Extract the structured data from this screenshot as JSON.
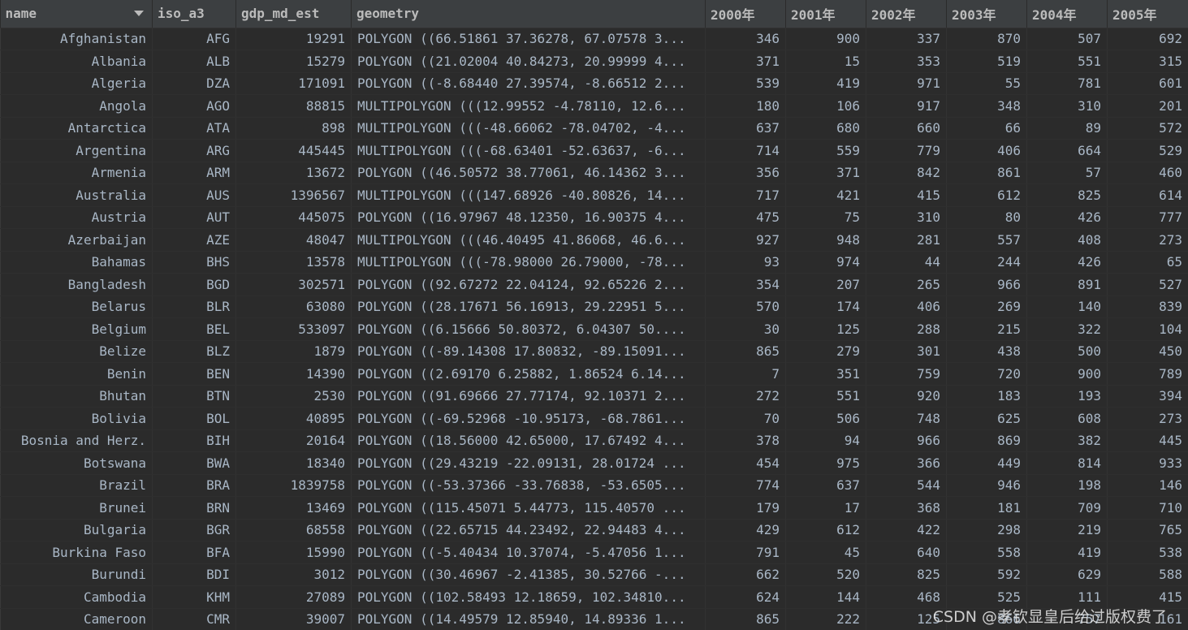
{
  "table": {
    "columns": [
      "name",
      "iso_a3",
      "gdp_md_est",
      "geometry",
      "2000年",
      "2001年",
      "2002年",
      "2003年",
      "2004年",
      "2005年"
    ],
    "sorted_column_icon": "sort-desc-icon",
    "rows": [
      [
        "Afghanistan",
        "AFG",
        "19291",
        "POLYGON ((66.51861 37.36278, 67.07578 3...",
        "346",
        "900",
        "337",
        "870",
        "507",
        "692"
      ],
      [
        "Albania",
        "ALB",
        "15279",
        "POLYGON ((21.02004 40.84273, 20.99999 4...",
        "371",
        "15",
        "353",
        "519",
        "551",
        "315"
      ],
      [
        "Algeria",
        "DZA",
        "171091",
        "POLYGON ((-8.68440 27.39574, -8.66512 2...",
        "539",
        "419",
        "971",
        "55",
        "781",
        "601"
      ],
      [
        "Angola",
        "AGO",
        "88815",
        "MULTIPOLYGON (((12.99552 -4.78110, 12.6...",
        "180",
        "106",
        "917",
        "348",
        "310",
        "201"
      ],
      [
        "Antarctica",
        "ATA",
        "898",
        "MULTIPOLYGON (((-48.66062 -78.04702, -4...",
        "637",
        "680",
        "660",
        "66",
        "89",
        "572"
      ],
      [
        "Argentina",
        "ARG",
        "445445",
        "MULTIPOLYGON (((-68.63401 -52.63637, -6...",
        "714",
        "559",
        "779",
        "406",
        "664",
        "529"
      ],
      [
        "Armenia",
        "ARM",
        "13672",
        "POLYGON ((46.50572 38.77061, 46.14362 3...",
        "356",
        "371",
        "842",
        "861",
        "57",
        "460"
      ],
      [
        "Australia",
        "AUS",
        "1396567",
        "MULTIPOLYGON (((147.68926 -40.80826, 14...",
        "717",
        "421",
        "415",
        "612",
        "825",
        "614"
      ],
      [
        "Austria",
        "AUT",
        "445075",
        "POLYGON ((16.97967 48.12350, 16.90375 4...",
        "475",
        "75",
        "310",
        "80",
        "426",
        "777"
      ],
      [
        "Azerbaijan",
        "AZE",
        "48047",
        "MULTIPOLYGON (((46.40495 41.86068, 46.6...",
        "927",
        "948",
        "281",
        "557",
        "408",
        "273"
      ],
      [
        "Bahamas",
        "BHS",
        "13578",
        "MULTIPOLYGON (((-78.98000 26.79000, -78...",
        "93",
        "974",
        "44",
        "244",
        "426",
        "65"
      ],
      [
        "Bangladesh",
        "BGD",
        "302571",
        "POLYGON ((92.67272 22.04124, 92.65226 2...",
        "354",
        "207",
        "265",
        "966",
        "891",
        "527"
      ],
      [
        "Belarus",
        "BLR",
        "63080",
        "POLYGON ((28.17671 56.16913, 29.22951 5...",
        "570",
        "174",
        "406",
        "269",
        "140",
        "839"
      ],
      [
        "Belgium",
        "BEL",
        "533097",
        "POLYGON ((6.15666 50.80372, 6.04307 50....",
        "30",
        "125",
        "288",
        "215",
        "322",
        "104"
      ],
      [
        "Belize",
        "BLZ",
        "1879",
        "POLYGON ((-89.14308 17.80832, -89.15091...",
        "865",
        "279",
        "301",
        "438",
        "500",
        "450"
      ],
      [
        "Benin",
        "BEN",
        "14390",
        "POLYGON ((2.69170 6.25882, 1.86524 6.14...",
        "7",
        "351",
        "759",
        "720",
        "900",
        "789"
      ],
      [
        "Bhutan",
        "BTN",
        "2530",
        "POLYGON ((91.69666 27.77174, 92.10371 2...",
        "272",
        "551",
        "920",
        "183",
        "193",
        "394"
      ],
      [
        "Bolivia",
        "BOL",
        "40895",
        "POLYGON ((-69.52968 -10.95173, -68.7861...",
        "70",
        "506",
        "748",
        "625",
        "608",
        "273"
      ],
      [
        "Bosnia and Herz.",
        "BIH",
        "20164",
        "POLYGON ((18.56000 42.65000, 17.67492 4...",
        "378",
        "94",
        "966",
        "869",
        "382",
        "445"
      ],
      [
        "Botswana",
        "BWA",
        "18340",
        "POLYGON ((29.43219 -22.09131, 28.01724 ...",
        "454",
        "975",
        "366",
        "449",
        "814",
        "933"
      ],
      [
        "Brazil",
        "BRA",
        "1839758",
        "POLYGON ((-53.37366 -33.76838, -53.6505...",
        "774",
        "637",
        "544",
        "946",
        "198",
        "146"
      ],
      [
        "Brunei",
        "BRN",
        "13469",
        "POLYGON ((115.45071 5.44773, 115.40570 ...",
        "179",
        "17",
        "368",
        "181",
        "709",
        "710"
      ],
      [
        "Bulgaria",
        "BGR",
        "68558",
        "POLYGON ((22.65715 44.23492, 22.94483 4...",
        "429",
        "612",
        "422",
        "298",
        "219",
        "765"
      ],
      [
        "Burkina Faso",
        "BFA",
        "15990",
        "POLYGON ((-5.40434 10.37074, -5.47056 1...",
        "791",
        "45",
        "640",
        "558",
        "419",
        "538"
      ],
      [
        "Burundi",
        "BDI",
        "3012",
        "POLYGON ((30.46967 -2.41385, 30.52766 -...",
        "662",
        "520",
        "825",
        "592",
        "629",
        "588"
      ],
      [
        "Cambodia",
        "KHM",
        "27089",
        "POLYGON ((102.58493 12.18659, 102.34810...",
        "624",
        "144",
        "468",
        "525",
        "111",
        "415"
      ],
      [
        "Cameroon",
        "CMR",
        "39007",
        "POLYGON ((14.49579 12.85940, 14.89336 1...",
        "865",
        "222",
        "125",
        "866",
        "757",
        "161"
      ]
    ]
  },
  "watermark": "CSDN @孝钦显皇后给过版权费了"
}
